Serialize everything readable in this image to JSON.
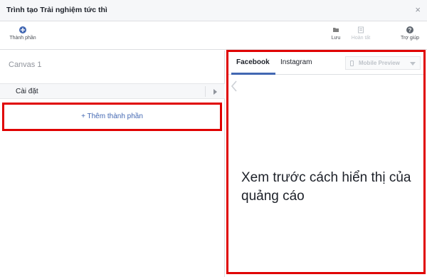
{
  "window": {
    "title": "Trình tạo Trải nghiệm tức thì",
    "close_glyph": "×"
  },
  "toolbar": {
    "add_component": {
      "label": "Thành phần",
      "icon": "plus-circle-icon",
      "color": "#4267b2"
    },
    "save": {
      "label": "Lưu",
      "icon": "folder-icon"
    },
    "finish": {
      "label": "Hoàn tất",
      "icon": "document-icon",
      "disabled": true
    },
    "help": {
      "label": "Trợ giúp",
      "icon": "question-circle-icon"
    }
  },
  "left_panel": {
    "canvas_title": "Canvas 1",
    "settings_label": "Cài đặt",
    "add_component_label": "+ Thêm thành phần"
  },
  "preview": {
    "tabs": [
      {
        "label": "Facebook",
        "active": true
      },
      {
        "label": "Instagram",
        "active": false
      }
    ],
    "device_select": {
      "label": "Mobile Preview",
      "disabled": true
    },
    "caption": "Xem trước cách hiển thị của quảng cáo"
  },
  "colors": {
    "highlight_border": "#e00000",
    "accent": "#4267b2",
    "muted": "#bec3c9"
  }
}
